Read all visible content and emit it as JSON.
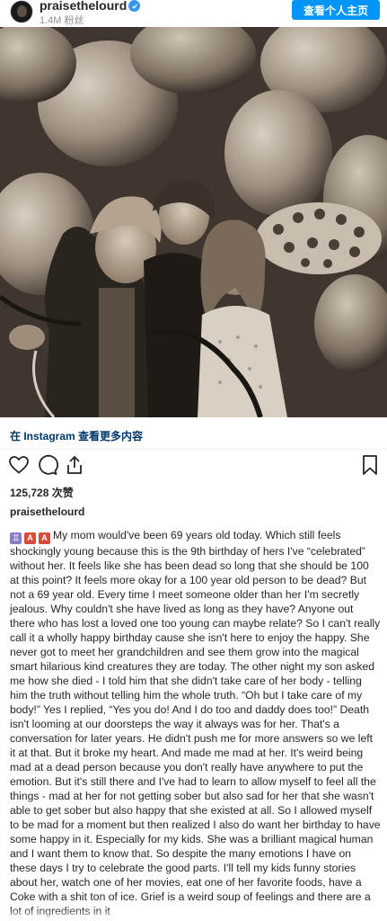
{
  "header": {
    "username": "praisethelourd",
    "followers": "1.4M 粉丝",
    "profile_button": "查看个人主页",
    "verified_icon": "verified-badge-icon"
  },
  "post": {
    "image_alt": "Vintage sepia photo of a woman, a younger woman and a girl among balloons",
    "instagram_link": "在 Instagram 查看更多内容",
    "likes": "125,728 次赞",
    "caption_user": "praisethelourd",
    "caption_emojis": [
      "♊",
      "A",
      "A"
    ],
    "caption_text": "My mom would've been 69 years old today. Which still feels shockingly young because this is the 9th birthday of hers I've “celebrated” without her. It feels like she has been dead so long that she should be 100 at this point? It feels more okay for a 100 year old person to be dead? But not a 69 year old. Every time I meet someone older than her I'm secretly jealous. Why couldn't she have lived as long as they have? Anyone out there who has lost a loved one too young can maybe relate? So I can't really call it a wholly happy birthday cause she isn't here to enjoy the happy. She never got to meet her grandchildren and see them grow into the magical smart hilarious kind creatures they are today. The other night my son asked me how she died - I told him that she didn't take care of her body - telling him the truth without telling him the whole truth. “Oh but I take care of my body!” Yes I replied, “Yes you do! And I do too and daddy does too!” Death isn't looming at our doorsteps the way it always was for her. That's a conversation for later years. He didn't push me for more answers so we left it at that. But it broke my heart. And made me mad at her. It's weird being mad at a dead person because you don't really have anywhere to put the emotion. But it's still there and I've had to learn to allow myself to feel all the things - mad at her for not getting sober but also sad for her that she wasn't able to get sober but also happy that she existed at all. So I allowed myself to be mad for a moment but then realized I also do want her birthday to have some happy in it. Especially for my kids. She was a brilliant magical human and I want them to know that. So despite the many emotions I have on these days I try to celebrate the good parts. I'll tell my kids funny stories about her, watch one of her movies, eat one of her favorite foods, have a Coke with a shit ton of ice. Grief is a weird soup of feelings and there are a lot of ingredients in it"
  },
  "icons": {
    "like": "heart-icon",
    "comment": "comment-icon",
    "share": "share-icon",
    "save": "bookmark-icon"
  }
}
